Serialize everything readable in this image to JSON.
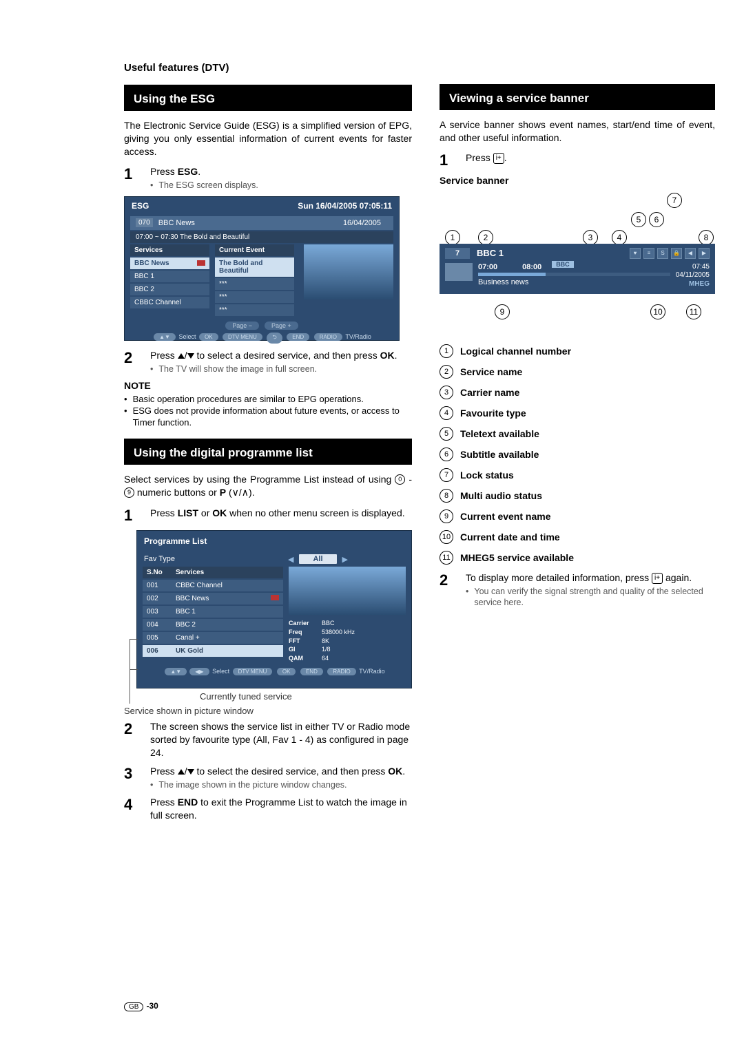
{
  "section_title": "Useful features (DTV)",
  "page_footer": "-30",
  "left": {
    "h1": "Using the ESG",
    "intro": "The Electronic Service Guide (ESG) is a simplified version of EPG, giving you only essential information of current events for faster access.",
    "steps": {
      "s1": {
        "num": "1",
        "text_a": "Press ",
        "bold": "ESG",
        "text_b": ".",
        "sub": "The ESG screen displays."
      },
      "s2": {
        "num": "2",
        "text_a": "Press ",
        "mid": " to select a desired service, and then press ",
        "bold": "OK",
        "text_b": ".",
        "sub": "The TV will show the image in full screen."
      }
    },
    "note_head": "NOTE",
    "note1": "Basic operation procedures are similar to EPG operations.",
    "note2": "ESG does not provide information about future events, or access to Timer function.",
    "h2": "Using the digital programme list",
    "intro2_a": "Select services by using the Programme List instead of using ",
    "intro2_b": " numeric buttons or ",
    "intro2_p": "P",
    "intro2_c": ".",
    "stepsB": {
      "s1": {
        "num": "1",
        "a": "Press ",
        "b1": "LIST",
        "mid": " or ",
        "b2": "OK",
        "c": " when no other menu screen is displayed."
      },
      "s2": {
        "num": "2",
        "t": "The screen shows the service list in either TV or Radio mode sorted by favourite type (All, Fav 1 - 4) as configured in page 24."
      },
      "s3": {
        "num": "3",
        "a": "Press ",
        "mid": " to select the desired service, and then press ",
        "b": "OK",
        "c": ".",
        "sub": "The image shown in the picture window changes."
      },
      "s4": {
        "num": "4",
        "a": "Press ",
        "b": "END",
        "c": " to exit the Programme List to watch the image in full screen."
      }
    },
    "callout1": "Currently tuned service",
    "callout2": "Service shown in picture window",
    "esg": {
      "title": "ESG",
      "datetime": "Sun  16/04/2005  07:05:11",
      "chnum": "070",
      "chname": "BBC News",
      "date": "16/04/2005",
      "timerange": "07:00 ~ 07:30    The Bold and Beautiful",
      "col1": "Services",
      "col2": "Current Event",
      "rows": [
        {
          "n": "BBC News",
          "e": "The Bold and Beautiful"
        },
        {
          "n": "BBC 1",
          "e": "***"
        },
        {
          "n": "BBC 2",
          "e": "***"
        },
        {
          "n": "CBBC Channel",
          "e": "***"
        }
      ],
      "pminus": "Page −",
      "pplus": "Page +",
      "bar": [
        "Select",
        "OK",
        "DTV MENU",
        "END",
        "TV/Radio"
      ]
    },
    "plist": {
      "title": "Programme List",
      "fav": "Fav Type",
      "all": "All",
      "h1": "S.No",
      "h2": "Services",
      "rows": [
        {
          "n": "001",
          "s": "CBBC Channel"
        },
        {
          "n": "002",
          "s": "BBC News"
        },
        {
          "n": "003",
          "s": "BBC 1"
        },
        {
          "n": "004",
          "s": "BBC 2"
        },
        {
          "n": "005",
          "s": "Canal +"
        },
        {
          "n": "006",
          "s": "UK Gold"
        }
      ],
      "meta": {
        "Carrier": "BBC",
        "Freq": "538000 kHz",
        "FFT": "8K",
        "GI": "1/8",
        "QAM": "64"
      },
      "bar": [
        "Select",
        "DTV MENU",
        "OK",
        "END",
        "TV/Radio"
      ]
    }
  },
  "right": {
    "h1": "Viewing a service banner",
    "intro": "A service banner shows event names, start/end time of event, and other useful information.",
    "step1": {
      "num": "1",
      "a": "Press ",
      "c": "."
    },
    "sb_head": "Service banner",
    "banner": {
      "chnum": "7",
      "chname": "BBC 1",
      "carrier": "BBC",
      "t1": "07:00",
      "t2": "08:00",
      "event": "Business news",
      "time": "07:45",
      "date": "04/11/2005",
      "mheg": "MHEG"
    },
    "legend": [
      "Logical channel number",
      "Service name",
      "Carrier name",
      "Favourite type",
      "Teletext available",
      "Subtitle available",
      "Lock status",
      "Multi audio status",
      "Current event name",
      "Current date and time",
      "MHEG5 service available"
    ],
    "step2": {
      "num": "2",
      "a": "To display more detailed information, press ",
      "c": " again.",
      "sub": "You can verify the signal strength and quality of the selected service here."
    }
  }
}
